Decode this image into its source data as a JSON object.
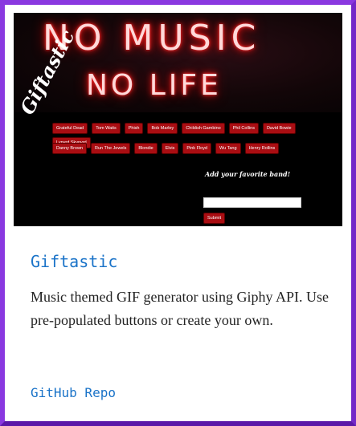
{
  "screenshot": {
    "banner_line1": "NO MUSIC",
    "banner_line2": "NO LIFE",
    "logo": "Giftastic",
    "buttons_row1": [
      "Grateful Dead",
      "Tom Waits",
      "Phish",
      "Bob Marley",
      "Childish Gambino",
      "Phil Collins",
      "David Bowie",
      "Lynyrd Skynyrd"
    ],
    "buttons_row2": [
      "Danny Brown",
      "Run The Jewels",
      "Blondie",
      "Elvis",
      "Pink Floyd",
      "Wu Tang",
      "Henry Rollins"
    ],
    "add_label": "Add your favorite band!",
    "submit_label": "Submit"
  },
  "card": {
    "title": "Giftastic",
    "description": "Music themed GIF generator using Giphy API. Use pre-populated buttons or create your own.",
    "link_label": "GitHub Repo"
  },
  "colors": {
    "border": "#8a38e0",
    "accent_link": "#1a73c8",
    "button_red": "#a90d12"
  }
}
